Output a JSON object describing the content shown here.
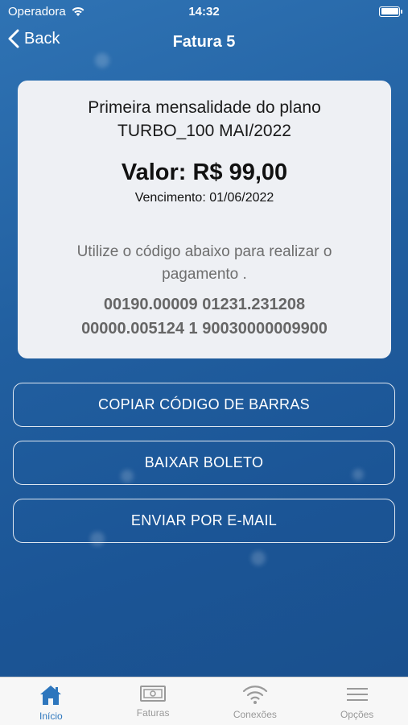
{
  "status_bar": {
    "carrier": "Operadora",
    "time": "14:32"
  },
  "navbar": {
    "back_label": "Back",
    "title": "Fatura 5"
  },
  "invoice": {
    "description": "Primeira mensalidade do plano TURBO_100 MAI/2022",
    "valor": "Valor: R$ 99,00",
    "vencimento": "Vencimento: 01/06/2022",
    "instruction": "Utilize o código abaixo para realizar o pagamento .",
    "barcode_line1": "00190.00009 01231.231208",
    "barcode_line2": "00000.005124 1 90030000009900"
  },
  "actions": {
    "copy_label": "COPIAR CÓDIGO DE BARRAS",
    "download_label": "BAIXAR BOLETO",
    "email_label": "ENVIAR POR E-MAIL"
  },
  "tabbar": {
    "items": [
      {
        "label": "Início",
        "icon": "home-icon",
        "active": true
      },
      {
        "label": "Faturas",
        "icon": "banknote-icon",
        "active": false
      },
      {
        "label": "Conexões",
        "icon": "wifi-icon",
        "active": false
      },
      {
        "label": "Opções",
        "icon": "menu-icon",
        "active": false
      }
    ],
    "active_color": "#2d76bd",
    "inactive_color": "#999999"
  }
}
